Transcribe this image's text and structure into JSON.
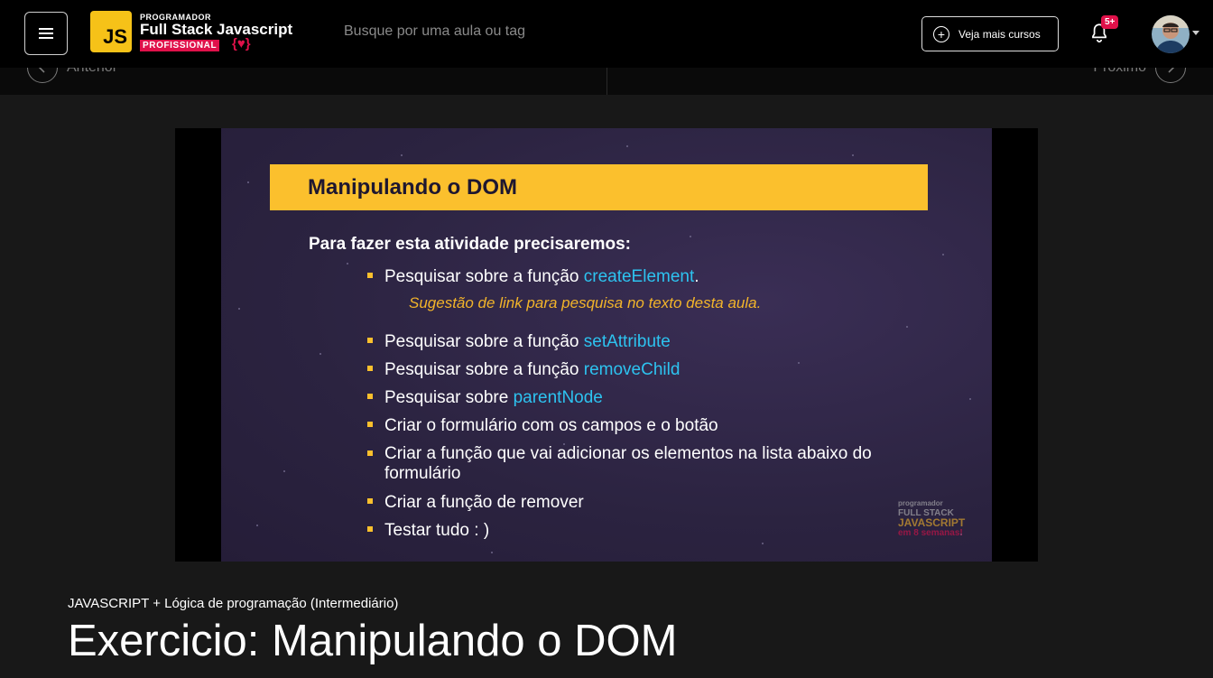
{
  "header": {
    "menu_icon": "hamburger-menu-icon",
    "logo": {
      "badge": "JS",
      "top_line": "PROGRAMADOR",
      "main_line": "Full Stack Javascript",
      "tag_line": "PROFISSIONAL",
      "brace": "{♥}"
    },
    "search_placeholder": "Busque por uma aula ou tag",
    "more_courses_label": "Veja mais cursos",
    "notification_badge": "5+"
  },
  "lesson_nav": {
    "prev_label": "Anterior",
    "next_label": "Próximo"
  },
  "slide": {
    "title": "Manipulando o DOM",
    "intro": "Para fazer esta atividade precisaremos:",
    "items": [
      {
        "text": "Pesquisar sobre a função ",
        "highlight": "createElement",
        "suffix": "."
      },
      {
        "text": "Pesquisar sobre a função ",
        "highlight": "setAttribute",
        "suffix": ""
      },
      {
        "text": "Pesquisar sobre a função ",
        "highlight": "removeChild",
        "suffix": ""
      },
      {
        "text": "Pesquisar sobre ",
        "highlight": "parentNode",
        "suffix": ""
      },
      {
        "text": "Criar o formulário com os campos e o botão"
      },
      {
        "text": "Criar a função que vai adicionar os elementos na lista abaixo do formulário"
      },
      {
        "text": "Criar a função de remover"
      },
      {
        "text": "Testar tudo : )"
      }
    ],
    "suggestion": "Sugestão de link para pesquisa no texto desta aula.",
    "watermark": {
      "line1": "programador",
      "line2": "FULL STACK",
      "line3": "JAVASCRIPT",
      "line4": "em 8 semanas!"
    }
  },
  "course": {
    "category": "JAVASCRIPT + Lógica de programação (Intermediário)",
    "lesson_title": "Exercicio: Manipulando o DOM"
  }
}
